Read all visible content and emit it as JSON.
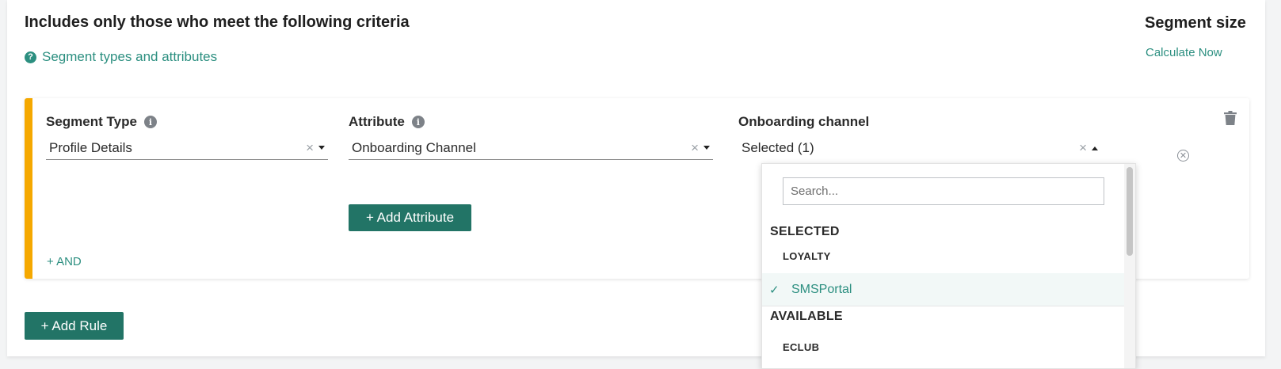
{
  "header": {
    "title": "Includes only those who meet the following criteria",
    "help_link": "Segment types and attributes",
    "segment_size_title": "Segment size",
    "calculate_link": "Calculate Now"
  },
  "rule": {
    "segment_type_label": "Segment Type",
    "segment_type_value": "Profile Details",
    "attribute_label": "Attribute",
    "attribute_value": "Onboarding Channel",
    "channel_label": "Onboarding channel",
    "channel_value": "Selected (1)",
    "add_attribute": "+ Add Attribute",
    "and_link": "+ AND",
    "clear_symbol": "×"
  },
  "dropdown": {
    "search_placeholder": "Search...",
    "selected_heading": "SELECTED",
    "selected_group": "LOYALTY",
    "selected_option": "SMSPortal",
    "available_heading": "AVAILABLE",
    "available_group": "ECLUB"
  },
  "footer": {
    "add_rule": "+ Add Rule"
  },
  "colors": {
    "accent": "#2c8f80",
    "button": "#227466",
    "rule_bar": "#f5a800"
  },
  "icons": {
    "help": "question-circle-icon",
    "info": "info-circle-icon",
    "trash": "trash-icon",
    "remove": "close-circle-icon",
    "check": "check-icon"
  }
}
